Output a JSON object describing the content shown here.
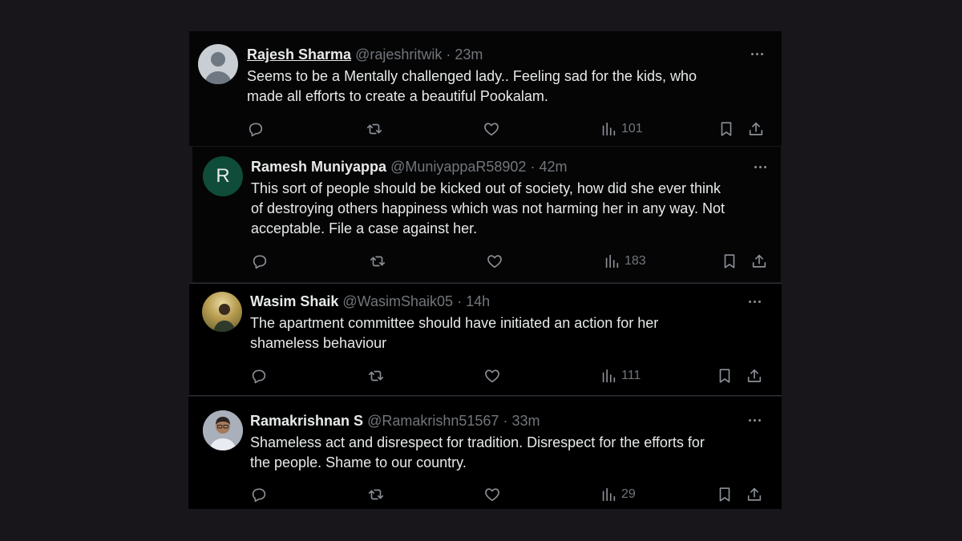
{
  "colors": {
    "page_background": "#18161b",
    "tweet_background": "#000000",
    "text_primary": "#e7e9ea",
    "text_secondary": "#71767b",
    "avatar_r_bg": "#0f4c3a"
  },
  "tweets": [
    {
      "name": "Rajesh Sharma",
      "handle": "@rajeshritwik",
      "separator": "·",
      "time": "23m",
      "text": "Seems to be a Mentally challenged lady.. Feeling sad for the kids, who\nmade all  efforts to create a beautiful Pookalam.",
      "avatar": "default-avatar",
      "views": "101"
    },
    {
      "name": "Ramesh Muniyappa",
      "handle": "@MuniyappaR58902",
      "separator": "·",
      "time": "42m",
      "text": "This sort of people should be kicked out of society, how did she ever think\nof destroying others happiness which was not harming her in any way.  Not\nacceptable.  File a case against her.",
      "avatar": "letter-avatar",
      "avatar_letter": "R",
      "views": "183"
    },
    {
      "name": "Wasim Shaik",
      "handle": "@WasimShaik05",
      "separator": "·",
      "time": "14h",
      "text": "The apartment committee should have initiated an action for her\nshameless behaviour",
      "avatar": "photo-avatar",
      "views": "111"
    },
    {
      "name": "Ramakrishnan S",
      "handle": "@Ramakrishn51567",
      "separator": "·",
      "time": "33m",
      "text": "Shameless act and disrespect for tradition. Disrespect for the efforts for\nthe people. Shame to our country.",
      "avatar": "photo-avatar",
      "views": "29"
    }
  ],
  "icons": [
    "reply-icon",
    "retweet-icon",
    "like-icon",
    "views-icon",
    "bookmark-icon",
    "share-icon",
    "more-icon"
  ]
}
